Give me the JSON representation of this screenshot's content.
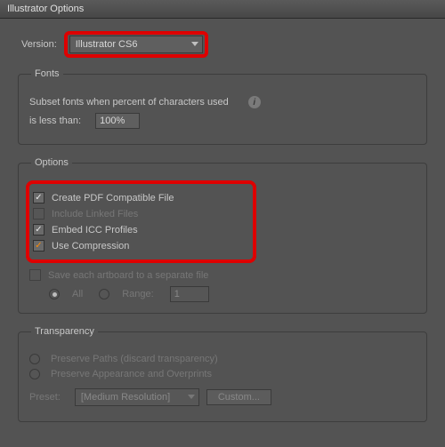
{
  "window": {
    "title": "Illustrator Options"
  },
  "version": {
    "label": "Version:",
    "value": "Illustrator CS6"
  },
  "fonts": {
    "legend": "Fonts",
    "subset_label": "Subset fonts when percent of characters used",
    "less_than_label": "is less than:",
    "value": "100%"
  },
  "options": {
    "legend": "Options",
    "pdf_compatible": "Create PDF Compatible File",
    "include_linked": "Include Linked Files",
    "embed_icc": "Embed ICC Profiles",
    "use_compression": "Use Compression",
    "save_artboards": "Save each artboard to a separate file",
    "radio_all": "All",
    "radio_range": "Range:",
    "range_value": "1"
  },
  "transparency": {
    "legend": "Transparency",
    "preserve_paths": "Preserve Paths (discard transparency)",
    "preserve_appearance": "Preserve Appearance and Overprints",
    "preset_label": "Preset:",
    "preset_value": "[Medium Resolution]",
    "custom_button": "Custom..."
  }
}
